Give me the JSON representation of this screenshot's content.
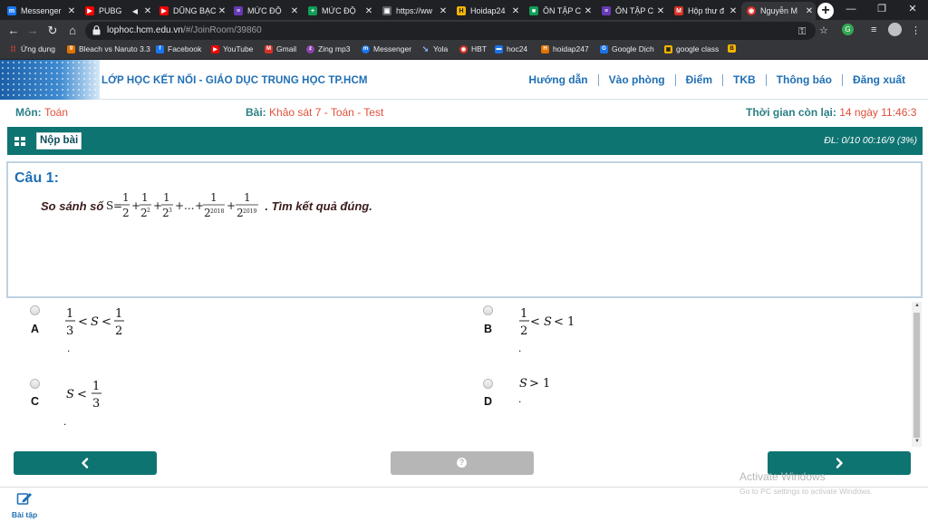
{
  "browser": {
    "tabs": [
      {
        "title": "Messenger",
        "icon": "messenger-icon",
        "color": "#1877f2"
      },
      {
        "title": "PUBG",
        "icon": "youtube-icon",
        "color": "#ff0000",
        "extra": "◀"
      },
      {
        "title": "DŨNG BẠC",
        "icon": "youtube-icon",
        "color": "#ff0000"
      },
      {
        "title": "MỨC ĐỘ",
        "icon": "forms-icon",
        "color": "#673ab7"
      },
      {
        "title": "MỨC ĐỘ",
        "icon": "sheets-icon",
        "color": "#0f9d58"
      },
      {
        "title": "https://ww",
        "icon": "web-icon",
        "color": "#5f6368"
      },
      {
        "title": "Hoidap24",
        "icon": "hoidap-icon",
        "color": "#f4b400"
      },
      {
        "title": "ÔN TẬP C",
        "icon": "classroom-icon",
        "color": "#0f9d58"
      },
      {
        "title": "ÔN TẬP C",
        "icon": "forms-icon",
        "color": "#673ab7"
      },
      {
        "title": "Hộp thư đ",
        "icon": "gmail-icon",
        "color": "#d93025"
      },
      {
        "title": "Nguyễn M",
        "icon": "site-icon",
        "color": "#d93025"
      }
    ],
    "url_host": "lophoc.hcm.edu.vn",
    "url_path": "/#/JoinRoom/39860",
    "bookmarks": [
      {
        "label": "Ứng dụng",
        "icon": "apps-icon",
        "color": "#ea4335"
      },
      {
        "label": "Bleach vs Naruto 3.3",
        "icon": "game-icon",
        "color": "#e37400"
      },
      {
        "label": "Facebook",
        "icon": "facebook-icon",
        "color": "#1877f2"
      },
      {
        "label": "YouTube",
        "icon": "youtube-icon",
        "color": "#ff0000"
      },
      {
        "label": "Gmail",
        "icon": "gmail-icon",
        "color": "#d93025"
      },
      {
        "label": "Zing mp3",
        "icon": "zing-icon",
        "color": "#8e44ad"
      },
      {
        "label": "Messenger",
        "icon": "messenger-icon",
        "color": "#1877f2"
      },
      {
        "label": "Yola",
        "icon": "yola-icon",
        "color": "#1a73e8"
      },
      {
        "label": "HBT",
        "icon": "hbt-icon",
        "color": "#d93025"
      },
      {
        "label": "hoc24",
        "icon": "hoc24-icon",
        "color": "#1a73e8"
      },
      {
        "label": "hoidap247",
        "icon": "hoidap-icon",
        "color": "#e37400"
      },
      {
        "label": "Google Dịch",
        "icon": "translate-icon",
        "color": "#1a73e8"
      },
      {
        "label": "google class",
        "icon": "classroom-icon",
        "color": "#f4b400"
      },
      {
        "label": "",
        "icon": "bookmark-b-icon",
        "color": "#f4b400"
      }
    ]
  },
  "site": {
    "title": "LỚP HỌC KẾT NỐI - GIÁO DỤC TRUNG HỌC TP.HCM",
    "nav": [
      "Hướng dẫn",
      "Vào phòng",
      "Điểm",
      "TKB",
      "Thông báo",
      "Đăng xuất"
    ]
  },
  "info": {
    "subject_label": "Môn:",
    "subject_value": "Toán",
    "lesson_label": "Bài:",
    "lesson_value": "Khảo sát 7 - Toán - Test",
    "time_label": "Thời gian còn lại:",
    "time_value": "14 ngày 11:46:3"
  },
  "toolbar": {
    "submit_label": "Nộp bài",
    "progress": "ĐL: 0/10   00:16/9 (3%)"
  },
  "question": {
    "number_label": "Câu 1:",
    "prompt_before": "So sánh số",
    "prompt_after": ". Tìm kết quả đúng."
  },
  "answers": [
    {
      "letter": "A",
      "dot": "."
    },
    {
      "letter": "B",
      "dot": "."
    },
    {
      "letter": "C",
      "dot": "."
    },
    {
      "letter": "D",
      "dot": "."
    }
  ],
  "footer": {
    "label": "Bài tập"
  },
  "watermark": {
    "line1": "Activate Windows",
    "line2": "Go to PC settings to activate Windows."
  },
  "colors": {
    "teal": "#0e7472",
    "brand_blue": "#1f6fb5",
    "accent_red": "#e0503a"
  }
}
